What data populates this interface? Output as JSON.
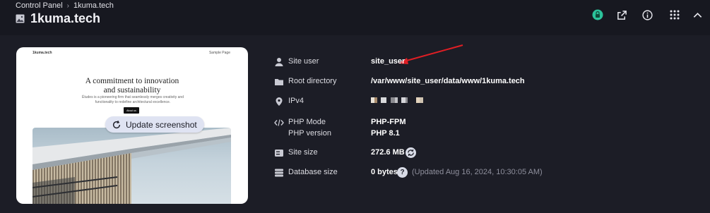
{
  "breadcrumb": {
    "parent": "Control Panel",
    "separator": "›",
    "current": "1kuma.tech"
  },
  "header": {
    "title": "1kuma.tech",
    "actions": [
      {
        "name": "status-icon",
        "color": "#2bc29a"
      },
      {
        "name": "external-link-icon"
      },
      {
        "name": "info-icon"
      },
      {
        "name": "apps-grid-icon"
      },
      {
        "name": "chevron-up-icon"
      }
    ]
  },
  "preview": {
    "site_name": "1kuma.tech",
    "nav_link": "Sample Page",
    "heading_line1": "A commitment to innovation",
    "heading_line2": "and sustainability",
    "sub_line1": "Études is a pioneering firm that seamlessly merges creativity and",
    "sub_line2": "functionality to redefine architectural excellence.",
    "cta": "About us",
    "update_button": "Update screenshot"
  },
  "details": {
    "site_user": {
      "label": "Site user",
      "value": "site_user",
      "icon": "user-icon"
    },
    "root_directory": {
      "label": "Root directory",
      "value": "/var/www/site_user/data/www/1kuma.tech",
      "icon": "folder-icon"
    },
    "ipv4": {
      "label": "IPv4",
      "icon": "location-pin-icon"
    },
    "php_mode": {
      "label": "PHP Mode",
      "value": "PHP-FPM",
      "icon": "code-icon"
    },
    "php_version": {
      "label": "PHP version",
      "value": "PHP 8.1"
    },
    "site_size": {
      "label": "Site size",
      "value": "272.6 MB",
      "icon": "disk-icon"
    },
    "database_size": {
      "label": "Database size",
      "value": "0 bytes",
      "icon": "database-icon",
      "help": "?",
      "updated": "(Updated Aug 16, 2024, 10:30:05 AM)"
    }
  },
  "annotation": {
    "arrow_color": "#e01e24"
  }
}
